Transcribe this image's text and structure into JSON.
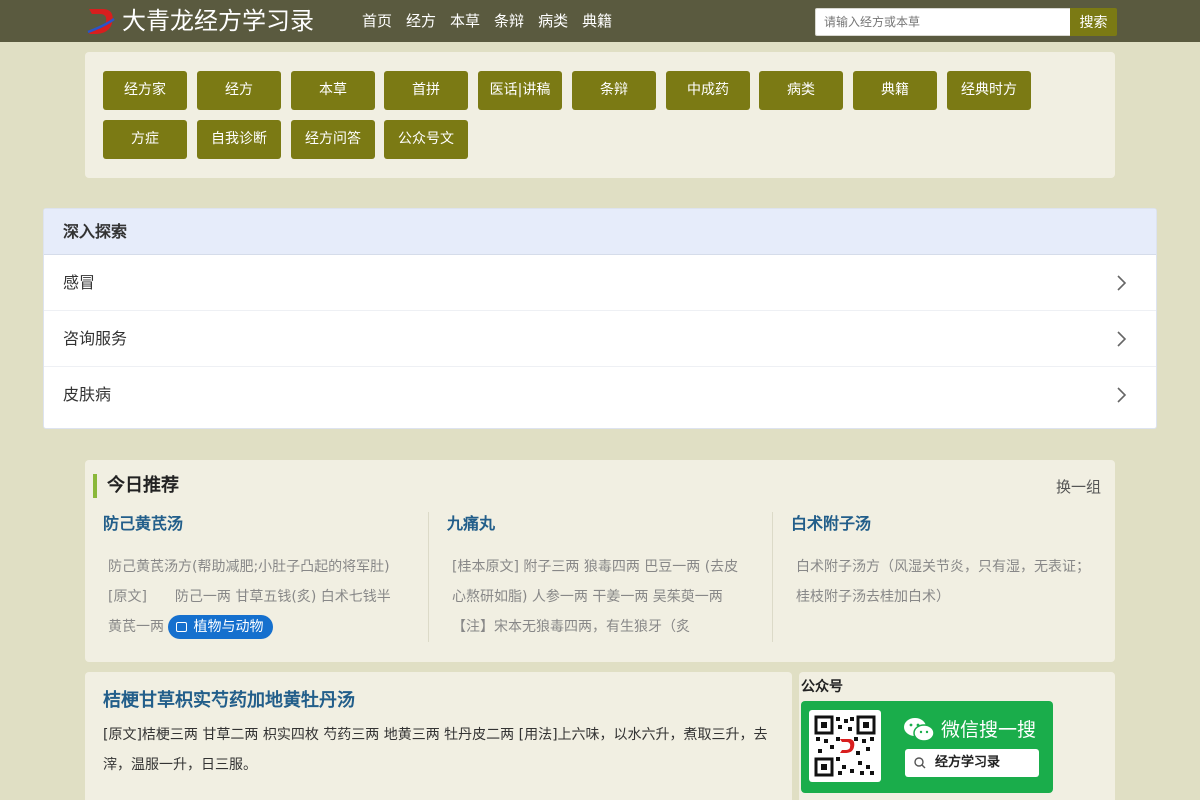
{
  "header": {
    "logo_letter": "D",
    "site_title": "大青龙经方学习录",
    "nav": [
      "首页",
      "经方",
      "本草",
      "条辩",
      "病类",
      "典籍"
    ],
    "search_placeholder": "请输入经方或本草",
    "search_button": "搜索"
  },
  "categories": [
    "经方家",
    "经方",
    "本草",
    "首拼",
    "医话|讲稿",
    "条辩",
    "中成药",
    "病类",
    "典籍",
    "经典时方",
    "方症",
    "自我诊断",
    "经方问答",
    "公众号文"
  ],
  "explore": {
    "title": "深入探索",
    "items": [
      "感冒",
      "咨询服务",
      "皮肤病"
    ]
  },
  "recommend": {
    "title": "今日推荐",
    "switch_label": "换一组",
    "items": [
      {
        "name": "防己黄芪汤",
        "desc": "防己黄芪汤方(帮助减肥;小肚子凸起的将军肚)[原文]　　防己一两 甘草五钱(炙) 白术七钱半 黄芪一两",
        "tag": "植物与动物"
      },
      {
        "name": "九痛丸",
        "desc": "[桂本原文] 附子三两 狼毒四两 巴豆一两 (去皮心熬研如脂) 人参一两 干姜一两 吴茱萸一两 【注】宋本无狼毒四两，有生狼牙（炙"
      },
      {
        "name": "白术附子汤",
        "desc": "白术附子汤方（风湿关节炎，只有湿，无表证；桂枝附子汤去桂加白术）"
      }
    ]
  },
  "article": {
    "title": "桔梗甘草枳实芍药加地黄牡丹汤",
    "body": "[原文]桔梗三两 甘草二两 枳实四枚 芍药三两 地黄三两 牡丹皮二两 [用法]上六味，以水六升，煮取三升，去滓，温服一升，日三服。"
  },
  "sidebar": {
    "title": "公众号",
    "wechat_text": "微信搜一搜",
    "search_text": "经方学习录"
  }
}
